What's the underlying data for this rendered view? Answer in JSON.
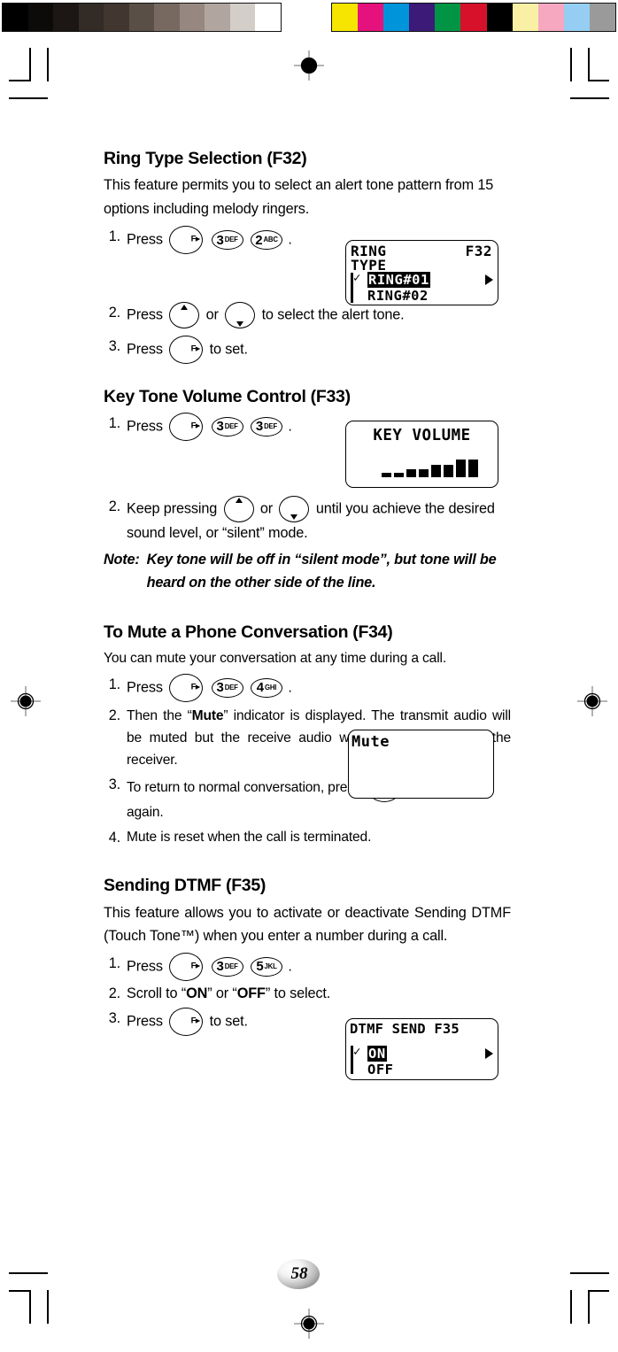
{
  "page": {
    "number": "58"
  },
  "calibration": {
    "grayscale_label": "grayscale-step-wedge",
    "grayscale_swatches": [
      "#000000",
      "#0d0a0a",
      "#1c1714",
      "#332b26",
      "#413630",
      "#5a4f47",
      "#77695f",
      "#968880",
      "#b0a69f",
      "#d4cec8",
      "#ffffff"
    ],
    "color_label": "color-control-patches",
    "color_swatches": [
      "#f5e500",
      "#e5127d",
      "#0095da",
      "#3b1a78",
      "#009444",
      "#d8112a",
      "#000000",
      "#faf0a5",
      "#f5a8c0",
      "#95cef2",
      "#9a9a9a"
    ]
  },
  "sections": [
    {
      "id": "ring-type-selection",
      "heading": "Ring Type Selection (F32)",
      "intro": "This feature permits you to select an alert tone pattern from 15 options including melody ringers.",
      "steps": [
        {
          "num": "1.",
          "pre": "Press",
          "post": "."
        },
        {
          "num": "2.",
          "pre": "Press",
          "mid": "or",
          "post": "to select the alert tone."
        },
        {
          "num": "3.",
          "pre": "Press",
          "post": "to set."
        }
      ],
      "lcd": {
        "name": "ring-type-lcd",
        "line1_left": "RING",
        "line1_right": "F32",
        "line2": "TYPE",
        "option_selected": "RING#01",
        "option_next": "RING#02",
        "check_glyph": "✓",
        "scroll_arrow": "▶"
      }
    },
    {
      "id": "key-tone-volume-control",
      "heading": "Key Tone Volume Control (F33)",
      "steps": [
        {
          "num": "1.",
          "pre": "Press",
          "post": "."
        },
        {
          "num": "2.",
          "pre": "Keep pressing",
          "mid": "or",
          "post": "until you achieve the desired sound level, or “silent” mode."
        }
      ],
      "note_label": "Note:",
      "note_text": "Key tone will be off in “silent mode”, but tone will be heard on the other side of the line.",
      "lcd": {
        "name": "key-volume-lcd",
        "title": "KEY VOLUME",
        "bar_levels": [
          5,
          5,
          9,
          9,
          14,
          14,
          20,
          20
        ],
        "bar_count": 8
      }
    },
    {
      "id": "to-mute-a-phone-conversation",
      "heading": "To Mute a Phone Conversation (F34)",
      "intro": "You can mute your conversation at any time during a call.",
      "steps": [
        {
          "num": "1.",
          "pre": "Press",
          "post": "."
        },
        {
          "num": "2.",
          "text_a": "Then the “",
          "bold": "Mute",
          "text_b": "” indicator is displayed. The transmit audio will be muted but the receive audio will still be heard from the receiver."
        },
        {
          "num": "3.",
          "pre": "To return to normal conversation, press",
          "post": "again."
        },
        {
          "num": "4.",
          "text": "Mute is reset when the call is terminated."
        }
      ],
      "lcd": {
        "name": "mute-lcd",
        "text": "Mute"
      }
    },
    {
      "id": "sending-dtmf",
      "heading": "Sending DTMF (F35)",
      "intro": "This feature allows you to activate or deactivate Sending DTMF (Touch Tone™) when you enter a number during a call.",
      "steps": [
        {
          "num": "1.",
          "pre": "Press",
          "post": "."
        },
        {
          "num": "2.",
          "text_a": "Scroll to “",
          "bold_a": "ON",
          "text_b": "” or “",
          "bold_b": "OFF",
          "text_c": "” to select."
        },
        {
          "num": "3.",
          "pre": "Press",
          "post": "to set."
        }
      ],
      "lcd": {
        "name": "dtmf-send-lcd",
        "title": "DTMF SEND F35",
        "option_selected": "ON",
        "option_next": "OFF",
        "check_glyph": "✓",
        "scroll_arrow": "▶"
      }
    }
  ],
  "keys": {
    "function": {
      "label": "F▸",
      "name": "function-key"
    },
    "three": {
      "digit": "3",
      "letters": "DEF"
    },
    "two": {
      "digit": "2",
      "letters": "ABC"
    },
    "four": {
      "digit": "4",
      "letters": "GHI"
    },
    "five": {
      "digit": "5",
      "letters": "JKL"
    },
    "up": {
      "name": "scroll-up-key"
    },
    "down": {
      "name": "scroll-down-key"
    }
  }
}
